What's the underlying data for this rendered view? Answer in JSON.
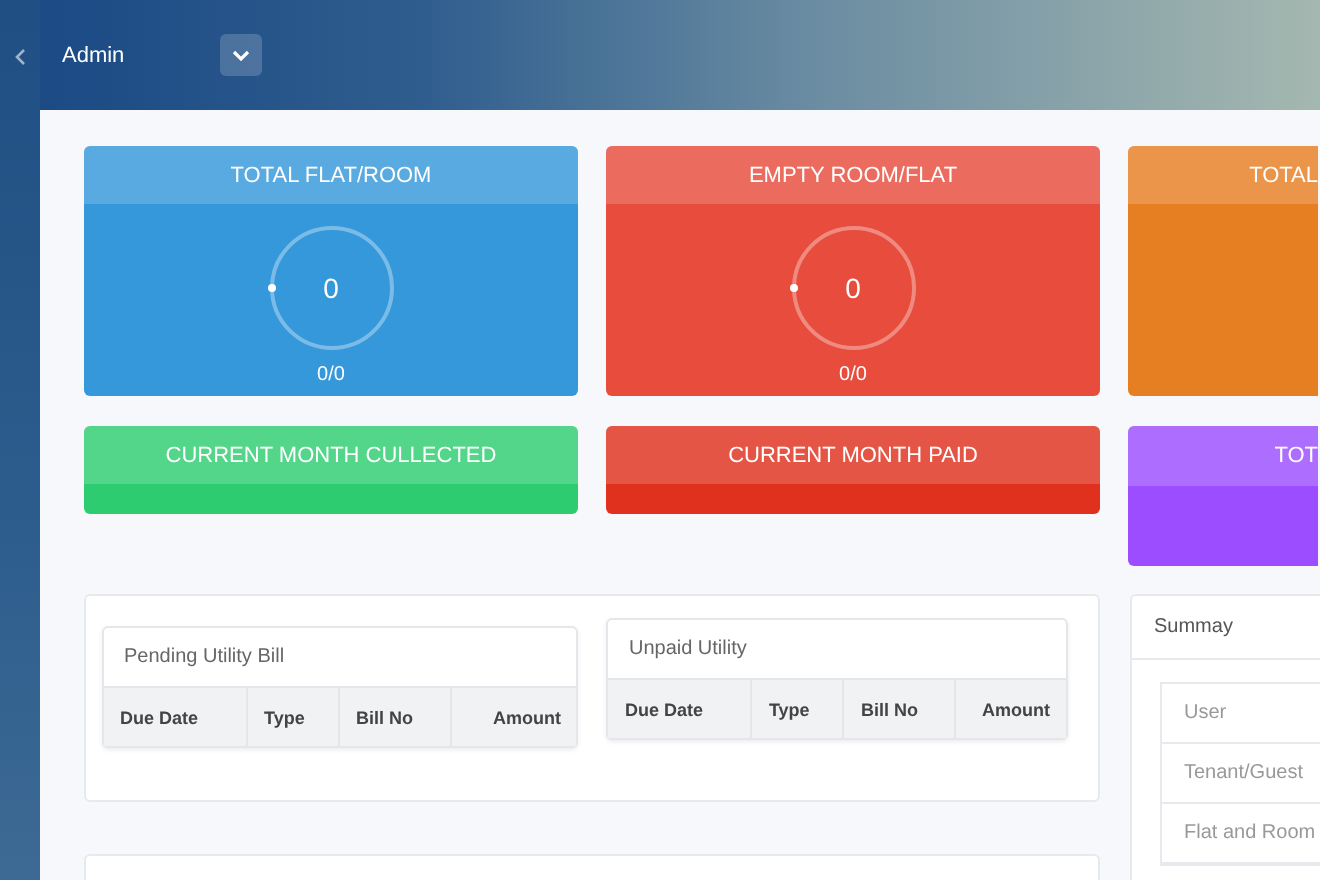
{
  "header": {
    "user": "Admin"
  },
  "stat_cards": [
    {
      "title": "TOTAL FLAT/ROOM",
      "value": "0",
      "ratio": "0/0",
      "color": "#3498db"
    },
    {
      "title": "EMPTY ROOM/FLAT",
      "value": "0",
      "ratio": "0/0",
      "color": "#e74c3c"
    },
    {
      "title": "TOTAL",
      "color": "#e67e22"
    }
  ],
  "month_cards": [
    {
      "title": "CURRENT MONTH CULLECTED",
      "color": "#2ecc71"
    },
    {
      "title": "CURRENT MONTH PAID",
      "color": "#e0301e"
    },
    {
      "title": "TOT",
      "color": "#9b4dff"
    }
  ],
  "utility_tables": [
    {
      "title": "Pending Utility Bill",
      "columns": [
        "Due Date",
        "Type",
        "Bill No",
        "Amount"
      ]
    },
    {
      "title": "Unpaid Utility",
      "columns": [
        "Due Date",
        "Type",
        "Bill No",
        "Amount"
      ]
    }
  ],
  "summary": {
    "title": "Summay",
    "items": [
      "User",
      "Tenant/Guest",
      "Flat and Room"
    ]
  }
}
